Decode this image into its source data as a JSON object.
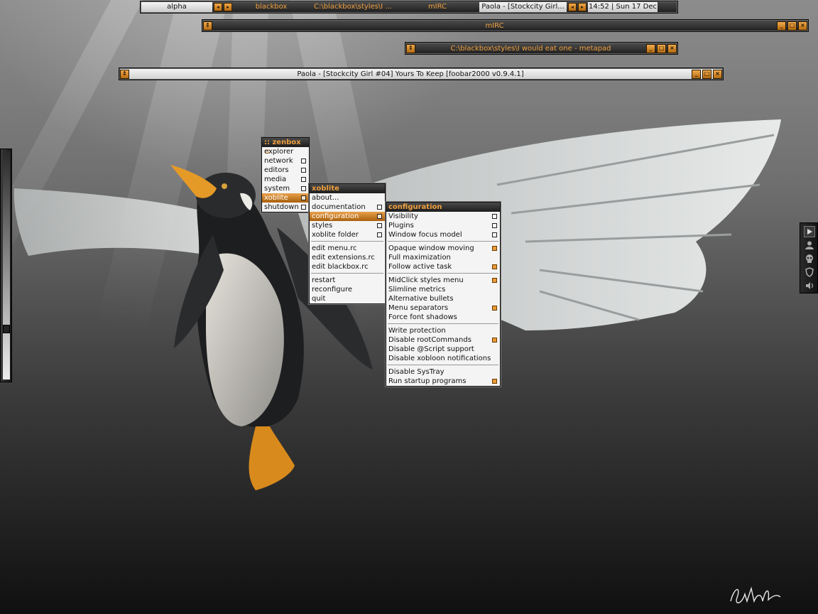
{
  "toolbar": {
    "workspace": "alpha",
    "tasks": [
      "blackbox",
      "C:\\blackbox\\styles\\I ...",
      "mIRC",
      "Paola - [Stockcity Girl..."
    ],
    "clock": "14:52 | Sun 17 Dec"
  },
  "windows": {
    "mirc": "mIRC",
    "metapad": "C:\\blackbox\\styles\\I would eat one - metapad",
    "foobar": "Paola - [Stockcity Girl #04] Yours To Keep   [foobar2000 v0.9.4.1]"
  },
  "zenbox_menu": {
    "title": ":: zenbox ::",
    "items": [
      "explorer",
      "network",
      "editors",
      "media",
      "system",
      "xoblite",
      "shutdown"
    ]
  },
  "xoblite_menu": {
    "title": "xoblite",
    "items": [
      "about...",
      "documentation",
      "configuration",
      "styles",
      "xoblite folder",
      "edit menu.rc",
      "edit extensions.rc",
      "edit blackbox.rc",
      "restart",
      "reconfigure",
      "quit"
    ]
  },
  "configuration_menu": {
    "title": "configuration",
    "items": [
      "Visibility",
      "Plugins",
      "Window focus model",
      "Opaque window moving",
      "Full maximization",
      "Follow active task",
      "MidClick styles menu",
      "Slimline metrics",
      "Alternative bullets",
      "Menu separators",
      "Force font shadows",
      "Write protection",
      "Disable rootCommands",
      "Disable @Script support",
      "Disable xobloon notifications",
      "Disable SysTray",
      "Run startup programs"
    ]
  },
  "colors": {
    "accent": "#f0a040",
    "highlight": "#c27a22",
    "menu_bg": "#f4f4f4",
    "bar_dark": "#1f1f1f"
  },
  "icons": {
    "arrow_left": "◂",
    "arrow_right": "▸",
    "updown": "⇕",
    "minimize": "_",
    "maximize": "□",
    "close": "×",
    "slit": [
      "play-icon",
      "user-icon",
      "skull-icon",
      "shield-icon",
      "speaker-icon"
    ]
  }
}
